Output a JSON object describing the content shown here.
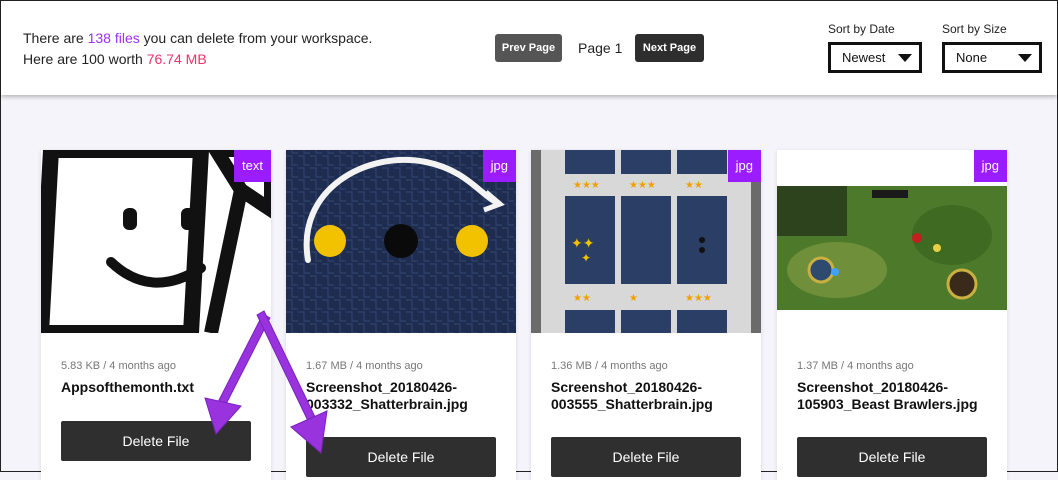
{
  "summary": {
    "line1_pre": "There are ",
    "file_count": "138 files",
    "line1_post": " you can delete from your workspace.",
    "line2_pre": "Here are 100 worth ",
    "total_size": "76.74 MB"
  },
  "pagination": {
    "prev_label": "Prev Page",
    "page_label": "Page 1",
    "next_label": "Next Page"
  },
  "sort": {
    "date_label": "Sort by Date",
    "date_value": "Newest",
    "size_label": "Sort by Size",
    "size_value": "None"
  },
  "files": [
    {
      "badge": "text",
      "meta": "5.83 KB / 4 months ago",
      "name": "Appsofthemonth.txt",
      "delete_label": "Delete File"
    },
    {
      "badge": "jpg",
      "meta": "1.67 MB / 4 months ago",
      "name": "Screenshot_20180426-003332_Shatterbrain.jpg",
      "delete_label": "Delete File"
    },
    {
      "badge": "jpg",
      "meta": "1.36 MB / 4 months ago",
      "name": "Screenshot_20180426-003555_Shatterbrain.jpg",
      "delete_label": "Delete File"
    },
    {
      "badge": "jpg",
      "meta": "1.37 MB / 4 months ago",
      "name": "Screenshot_20180426-105903_Beast Brawlers.jpg",
      "delete_label": "Delete File"
    }
  ],
  "colors": {
    "accent_purple": "#9b1cff",
    "count_color": "#9b30ff",
    "size_color": "#e8336d",
    "arrow_color": "#9933dd"
  }
}
